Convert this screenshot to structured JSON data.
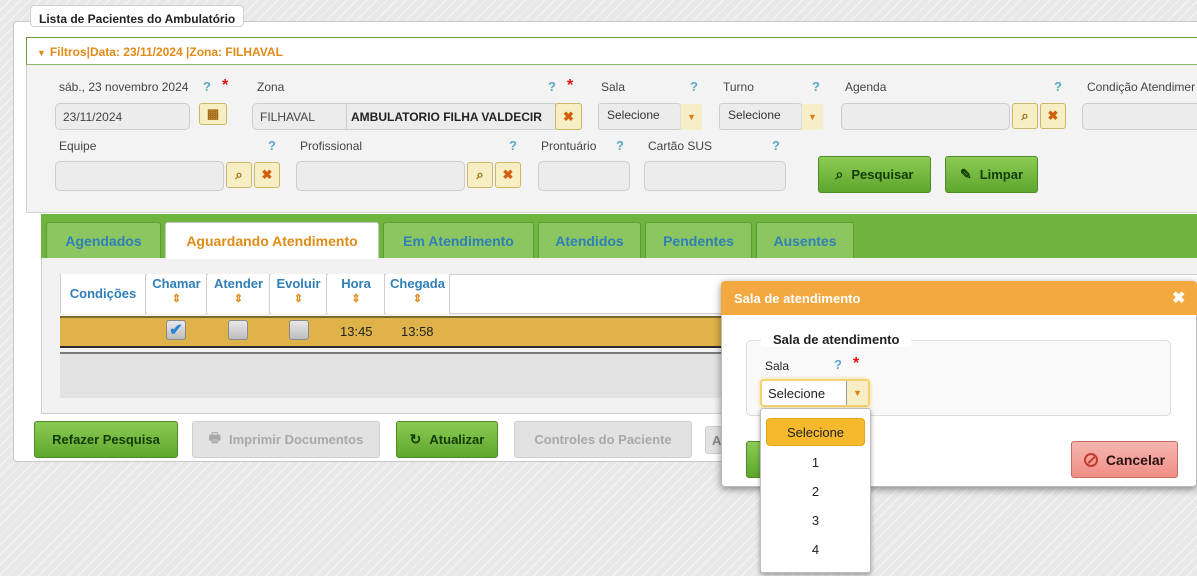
{
  "page": {
    "title": "Lista de Pacientes do Ambulatório"
  },
  "filters": {
    "header": "Filtros|Data: 23/11/2024 |Zona: FILHAVAL",
    "date_label": "sáb., 23 novembro 2024",
    "date_value": "23/11/2024",
    "zona_label": "Zona",
    "zona_code": "FILHAVAL",
    "zona_name": "AMBULATORIO FILHA VALDECIR",
    "sala_label": "Sala",
    "sala_value": "Selecione",
    "turno_label": "Turno",
    "turno_value": "Selecione",
    "agenda_label": "Agenda",
    "condicao_label": "Condição Atendimer",
    "equipe_label": "Equipe",
    "profissional_label": "Profissional",
    "prontuario_label": "Prontuário",
    "cartao_label": "Cartão SUS",
    "help_glyph": "?",
    "required_glyph": "*",
    "pesquisar_label": "Pesquisar",
    "limpar_label": "Limpar"
  },
  "tabs": [
    {
      "label": "Agendados"
    },
    {
      "label": "Aguardando Atendimento"
    },
    {
      "label": "Em Atendimento"
    },
    {
      "label": "Atendidos"
    },
    {
      "label": "Pendentes"
    },
    {
      "label": "Ausentes"
    }
  ],
  "table": {
    "columns": [
      "Condições",
      "Chamar",
      "Atender",
      "Evoluir",
      "Hora",
      "Chegada"
    ],
    "rows": [
      {
        "chamar_checked": true,
        "atender_checked": false,
        "evoluir_checked": false,
        "hora": "13:45",
        "chegada": "13:58"
      }
    ]
  },
  "actions": {
    "refazer": "Refazer Pesquisa",
    "imprimir": "Imprimir Documentos",
    "atualizar": "Atualizar",
    "controles": "Controles do Paciente",
    "partial": "A"
  },
  "dialog": {
    "title": "Sala de atendimento",
    "legend": "Sala de atendimento",
    "sala_label": "Sala",
    "select_value": "Selecione",
    "options": [
      "Selecione",
      "1",
      "2",
      "3",
      "4"
    ],
    "cancel_label": "Cancelar",
    "close_glyph": "✖"
  },
  "colors": {
    "accent_green": "#6fb43f",
    "accent_orange": "#f3a93f",
    "row_highlight": "#dfb24a",
    "link_blue": "#2f7fb8"
  }
}
